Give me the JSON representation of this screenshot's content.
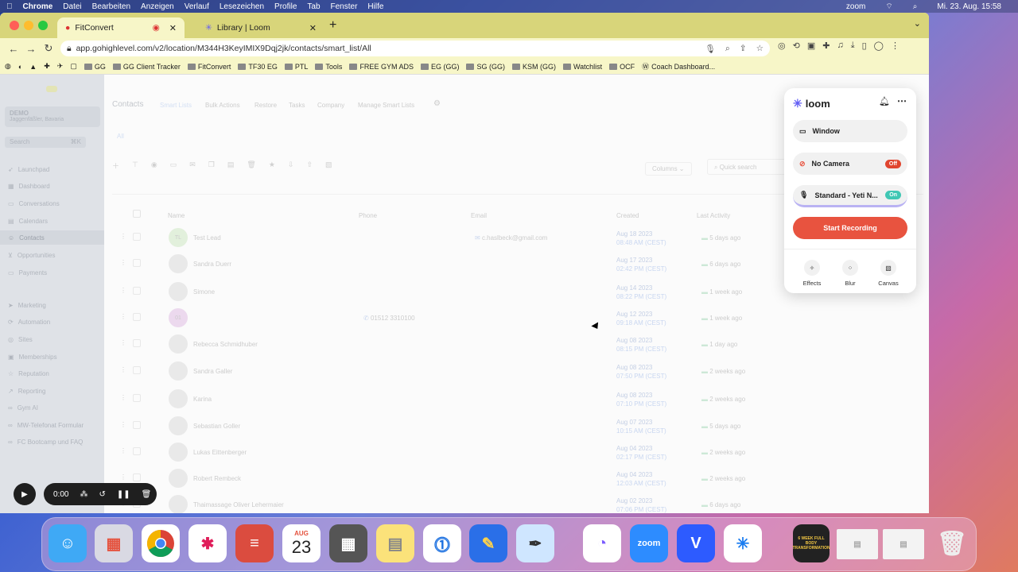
{
  "menubar": {
    "apple": "",
    "items": [
      "Chrome",
      "Datei",
      "Bearbeiten",
      "Anzeigen",
      "Verlauf",
      "Lesezeichen",
      "Profile",
      "Tab",
      "Fenster",
      "Hilfe"
    ],
    "zoom": "zoom",
    "datetime": "Mi. 23. Aug.  15:58"
  },
  "browser": {
    "tabs": [
      {
        "title": "FitConvert",
        "active": true
      },
      {
        "title": "Library | Loom",
        "active": false
      }
    ],
    "url": "app.gohighlevel.com/v2/location/M344H3KeyIMIX9Dqj2jk/contacts/smart_list/All",
    "bookmarks": [
      "GG",
      "GG Client Tracker",
      "FitConvert",
      "TF30 EG",
      "PTL",
      "Tools",
      "FREE GYM ADS",
      "EG (GG)",
      "SG (GG)",
      "KSM (GG)",
      "Watchlist",
      "OCF",
      "Coach Dashboard..."
    ]
  },
  "sidebar": {
    "account": "DEMO",
    "account_sub": "Jaggenfäßler, Bavaria",
    "search": "Search",
    "shortcut": "⌘K",
    "items": [
      "Launchpad",
      "Dashboard",
      "Conversations",
      "Calendars",
      "Contacts",
      "Opportunities",
      "Payments",
      "Marketing",
      "Automation",
      "Sites",
      "Memberships",
      "Reputation",
      "Reporting",
      "Gym AI",
      "MW-Telefonat Formular",
      "FC Bootcamp und FAQ"
    ]
  },
  "contacts": {
    "title": "Contacts",
    "tabs": [
      "Smart Lists",
      "Bulk Actions",
      "Restore",
      "Tasks",
      "Company",
      "Manage Smart Lists"
    ],
    "filter_tab": "All",
    "columns_btn": "Columns",
    "search_placeholder": "Quick search",
    "headers": [
      "Name",
      "Phone",
      "Email",
      "Created",
      "Last Activity"
    ],
    "rows": [
      {
        "initials": "TL",
        "name": "Test Lead",
        "phone": "",
        "email": "c.haslbeck@gmail.com",
        "date": "Aug 18 2023",
        "time": "08:48 AM (CEST)",
        "activity": "5 days ago"
      },
      {
        "initials": "",
        "name": "Sandra Duerr",
        "phone": "",
        "email": "",
        "date": "Aug 17 2023",
        "time": "02:42 PM (CEST)",
        "activity": "6 days ago"
      },
      {
        "initials": "",
        "name": "Simone",
        "phone": "",
        "email": "",
        "date": "Aug 14 2023",
        "time": "08:22 PM (CEST)",
        "activity": "1 week ago"
      },
      {
        "initials": "01",
        "name": "",
        "phone": "01512 3310100",
        "email": "",
        "date": "Aug 12 2023",
        "time": "09:18 AM (CEST)",
        "activity": "1 week ago"
      },
      {
        "initials": "",
        "name": "Rebecca Schmidhuber",
        "phone": "",
        "email": "",
        "date": "Aug 08 2023",
        "time": "08:15 PM (CEST)",
        "activity": "1 day ago"
      },
      {
        "initials": "",
        "name": "Sandra Galler",
        "phone": "",
        "email": "",
        "date": "Aug 08 2023",
        "time": "07:50 PM (CEST)",
        "activity": "2 weeks ago"
      },
      {
        "initials": "",
        "name": "Karina",
        "phone": "",
        "email": "",
        "date": "Aug 08 2023",
        "time": "07:10 PM (CEST)",
        "activity": "2 weeks ago"
      },
      {
        "initials": "",
        "name": "Sebastian Goller",
        "phone": "",
        "email": "",
        "date": "Aug 07 2023",
        "time": "10:15 AM (CEST)",
        "activity": "5 days ago"
      },
      {
        "initials": "",
        "name": "Lukas Eittenberger",
        "phone": "",
        "email": "",
        "date": "Aug 04 2023",
        "time": "02:17 PM (CEST)",
        "activity": "2 weeks ago"
      },
      {
        "initials": "",
        "name": "Robert Rembeck",
        "phone": "",
        "email": "",
        "date": "Aug 04 2023",
        "time": "12:03 AM (CEST)",
        "activity": "2 weeks ago"
      },
      {
        "initials": "",
        "name": "Thaimassage Oliver Lehermaier",
        "phone": "",
        "email": "",
        "date": "Aug 02 2023",
        "time": "07:06 PM (CEST)",
        "activity": "6 days ago"
      }
    ]
  },
  "loom": {
    "brand": "loom",
    "source": "Window",
    "camera": "No Camera",
    "camera_state": "Off",
    "mic": "Standard - Yeti N...",
    "mic_state": "On",
    "record": "Start Recording",
    "effects": [
      "Effects",
      "Blur",
      "Canvas"
    ],
    "accent": "#625df5",
    "record_color": "#e8533f"
  },
  "recorder": {
    "time": "0:00"
  },
  "dock": {
    "calendar_month": "AUG",
    "calendar_day": "23",
    "zoom_label": "zoom",
    "book_caption": "6 WEEK FULL BODY TRANSFORMATION"
  }
}
